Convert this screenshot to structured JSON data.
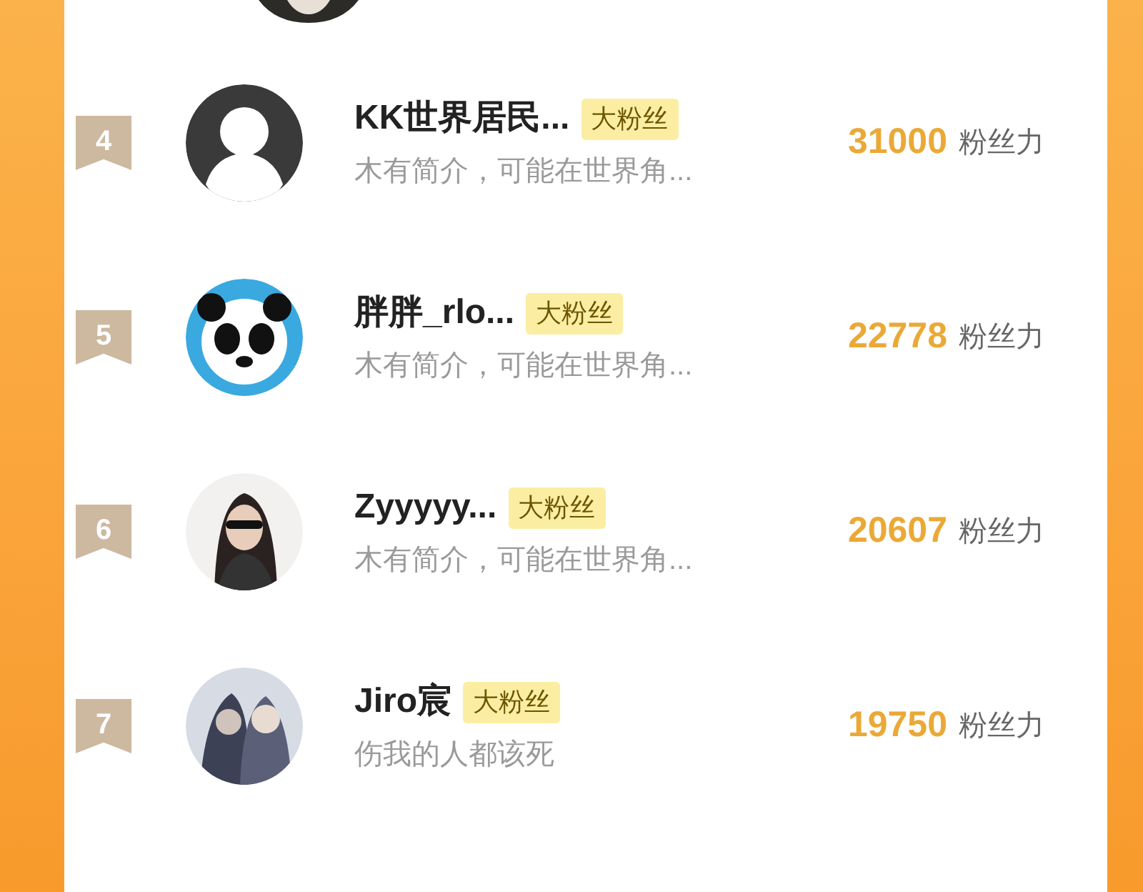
{
  "rows": [
    {
      "rank": "4",
      "name": "KK世界居民...",
      "tag": "大粉丝",
      "bio": "木有简介，可能在世界角...",
      "score": "31000",
      "score_unit": "粉丝力"
    },
    {
      "rank": "5",
      "name": "胖胖_rlo...",
      "tag": "大粉丝",
      "bio": "木有简介，可能在世界角...",
      "score": "22778",
      "score_unit": "粉丝力"
    },
    {
      "rank": "6",
      "name": "Zyyyyy...",
      "tag": "大粉丝",
      "bio": "木有简介，可能在世界角...",
      "score": "20607",
      "score_unit": "粉丝力"
    },
    {
      "rank": "7",
      "name": "Jiro宸",
      "tag": "大粉丝",
      "bio": "伤我的人都该死",
      "score": "19750",
      "score_unit": "粉丝力"
    }
  ]
}
